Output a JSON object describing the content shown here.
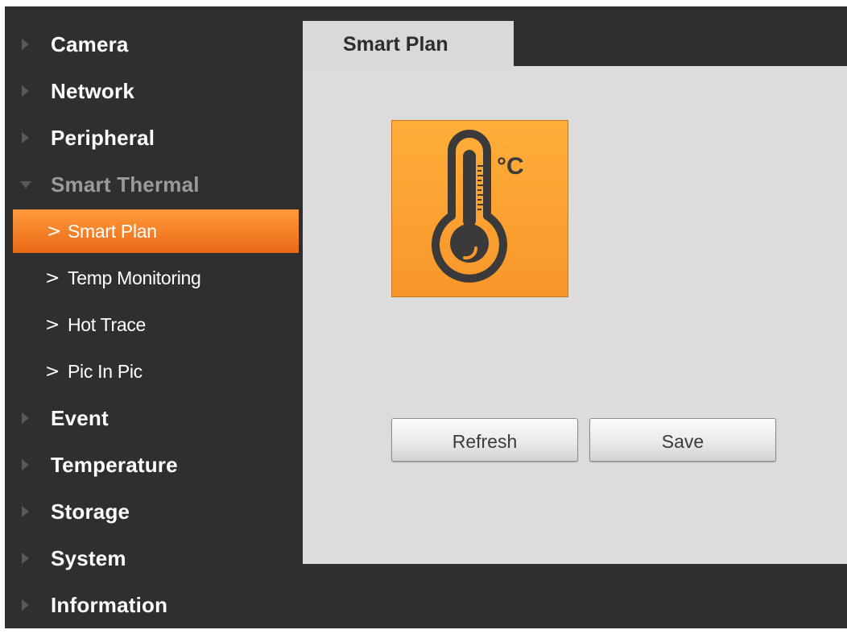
{
  "sidebar": {
    "top_categories": [
      {
        "label": "Camera"
      },
      {
        "label": "Network"
      },
      {
        "label": "Peripheral"
      }
    ],
    "expanded_category": {
      "label": "Smart Thermal",
      "items": [
        {
          "label": "Smart Plan",
          "active": true
        },
        {
          "label": "Temp Monitoring"
        },
        {
          "label": "Hot Trace"
        },
        {
          "label": "Pic In Pic"
        }
      ]
    },
    "bottom_categories": [
      {
        "label": "Event"
      },
      {
        "label": "Temperature"
      },
      {
        "label": "Storage"
      },
      {
        "label": "System"
      },
      {
        "label": "Information"
      }
    ],
    "chevron": ">"
  },
  "main": {
    "tab_label": "Smart Plan",
    "tile": {
      "icon": "thermometer-icon",
      "unit_text": "°C",
      "color": "#F8962A"
    },
    "buttons": {
      "refresh_label": "Refresh",
      "save_label": "Save"
    }
  },
  "colors": {
    "sidebar_bg": "#2F2F2F",
    "active_item": "#F7842A",
    "panel_bg": "#DCDCDC"
  }
}
